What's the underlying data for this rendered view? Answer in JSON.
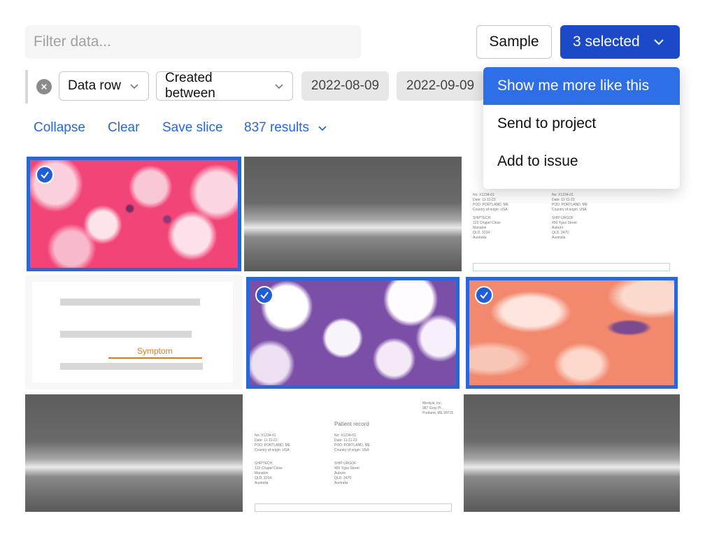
{
  "search": {
    "placeholder": "Filter data..."
  },
  "toolbar": {
    "sample_label": "Sample",
    "selected_label": "3 selected"
  },
  "filters": {
    "field_label": "Data row",
    "condition_label": "Created between",
    "date_from": "2022-08-09",
    "date_to": "2022-09-09"
  },
  "actions": {
    "collapse": "Collapse",
    "clear": "Clear",
    "save_slice": "Save slice",
    "results": "837 results"
  },
  "dropdown": {
    "items": [
      {
        "label": "Show me more like this",
        "active": true
      },
      {
        "label": "Send to project",
        "active": false
      },
      {
        "label": "Add to issue",
        "active": false
      }
    ]
  },
  "grid": {
    "tiles": [
      {
        "kind": "histology-pink",
        "selected": true
      },
      {
        "kind": "retina-scan",
        "selected": false
      },
      {
        "kind": "document",
        "selected": false
      },
      {
        "kind": "text-annotation",
        "selected": false
      },
      {
        "kind": "histology-purple",
        "selected": true
      },
      {
        "kind": "histology-salmon",
        "selected": true
      },
      {
        "kind": "retina-scan",
        "selected": false
      },
      {
        "kind": "patient-record",
        "selected": false
      },
      {
        "kind": "retina-scan",
        "selected": false
      }
    ],
    "annotation_label": "Symptom",
    "patient_record_title": "Patient record"
  },
  "colors": {
    "accent": "#2866d9",
    "primary_button": "#1c49c7",
    "annotation": "#e07a1f"
  }
}
